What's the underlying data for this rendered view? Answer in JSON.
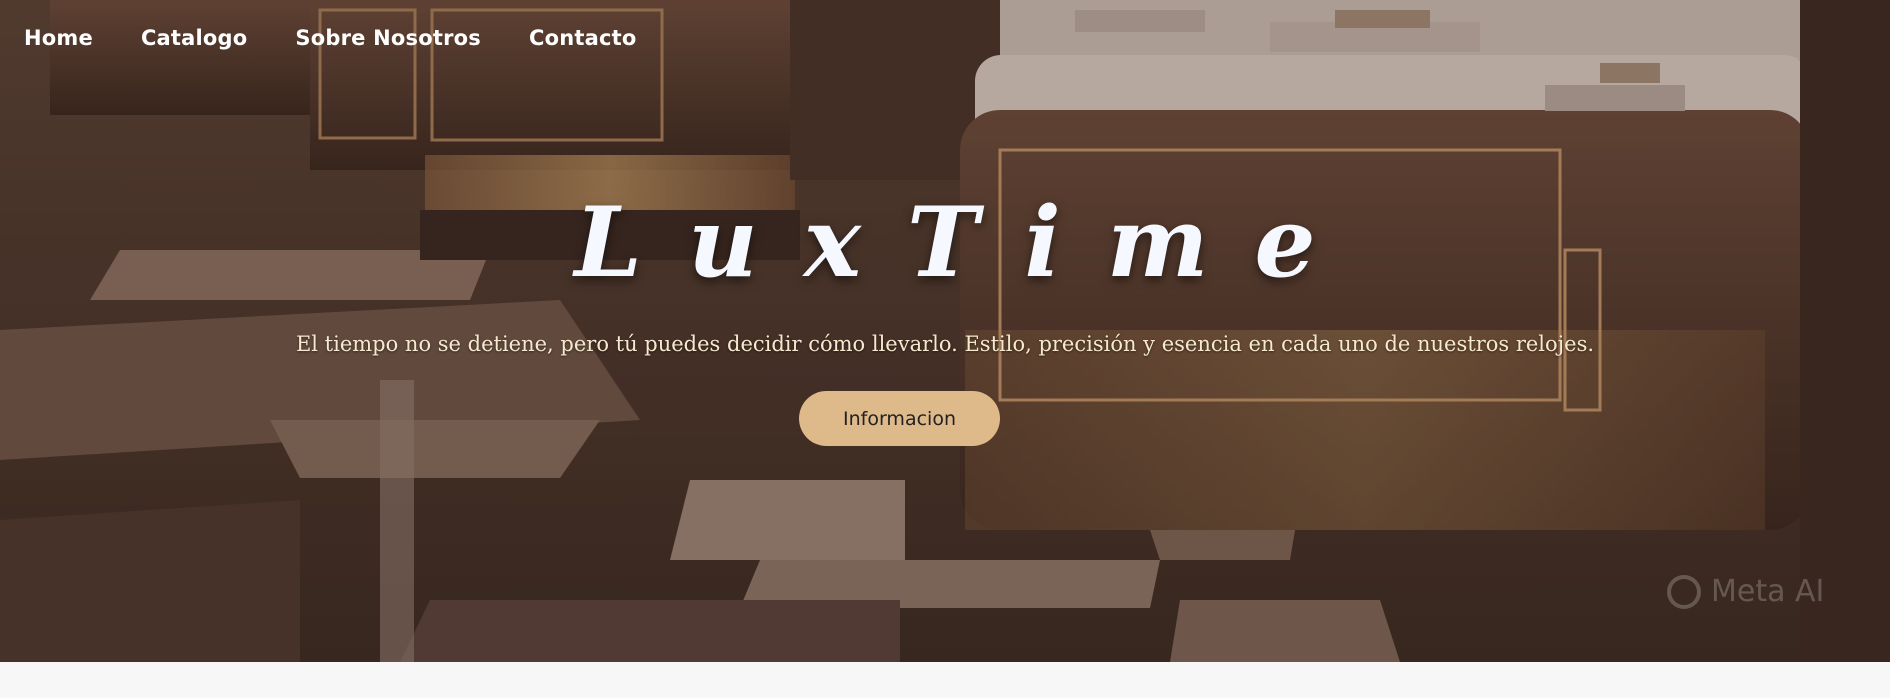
{
  "nav": {
    "items": [
      {
        "label": "Home"
      },
      {
        "label": "Catalogo"
      },
      {
        "label": "Sobre Nosotros"
      },
      {
        "label": "Contacto"
      }
    ]
  },
  "hero": {
    "title": "LuxTime",
    "subtitle": "El tiempo no se detiene, pero tú puedes decidir cómo llevarlo. Estilo, precisión y esencia en cada uno de nuestros relojes.",
    "cta_label": "Informacion",
    "watermark": "Meta AI"
  },
  "colors": {
    "cta_bg": "#deb98a",
    "title": "#f6f8ff",
    "subtitle": "#f7e9cf",
    "page_bg": "#f7f7f7"
  }
}
